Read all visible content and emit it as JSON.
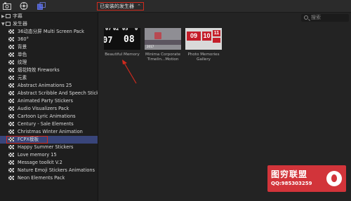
{
  "toolbar": {
    "icons": [
      "media-browser-icon",
      "titles-generators-icon",
      "effects-browser-icon"
    ],
    "dropdown_label": "已安装的发生器",
    "accent_border": "#d02a1e"
  },
  "sidebar": {
    "sections": [
      {
        "label": "字幕",
        "expanded": false
      },
      {
        "label": "发生器",
        "expanded": true
      }
    ],
    "items": [
      {
        "label": "36动态分屏 Multi Screen Pack"
      },
      {
        "label": "360°"
      },
      {
        "label": "背景"
      },
      {
        "label": "单色"
      },
      {
        "label": "纹理"
      },
      {
        "label": "烟花特效 Fireworks"
      },
      {
        "label": "元素"
      },
      {
        "label": "Abstract Animations 25"
      },
      {
        "label": "Abstract Scribble And Speech Stickers"
      },
      {
        "label": "Animated Party Stickers"
      },
      {
        "label": "Audio Visualizers Pack"
      },
      {
        "label": "Cartoon Lyric Animations"
      },
      {
        "label": "Century - Sale Elements"
      },
      {
        "label": "Christmas Winter Animation"
      },
      {
        "label": "FCPX模板",
        "selected": true
      },
      {
        "label": "Happy Summer Stickers"
      },
      {
        "label": "Love memory 15"
      },
      {
        "label": "Message toolkit V.2"
      },
      {
        "label": "Nature Emoji Stickers Animations"
      },
      {
        "label": "Neon Elements Pack"
      }
    ],
    "selected_color": "#39457a"
  },
  "main": {
    "search_placeholder": "搜索",
    "thumb1": {
      "nums": [
        "07",
        "02",
        "05",
        "0",
        "07",
        "08"
      ]
    },
    "thumb2": {
      "year": "2017"
    },
    "thumb3": {
      "nums": [
        "09",
        "10",
        "11"
      ]
    },
    "captions": [
      {
        "line1": "Beautiful Memory",
        "line2": ""
      },
      {
        "line1": "Minima Corporate",
        "line2": "Timelin...Motion"
      },
      {
        "line1": "Photo Memories",
        "line2": "Gallery"
      }
    ],
    "arrow_color": "#d02a1e"
  },
  "watermark": {
    "title": "图穷联盟",
    "subtitle": "QQ:985303259"
  }
}
